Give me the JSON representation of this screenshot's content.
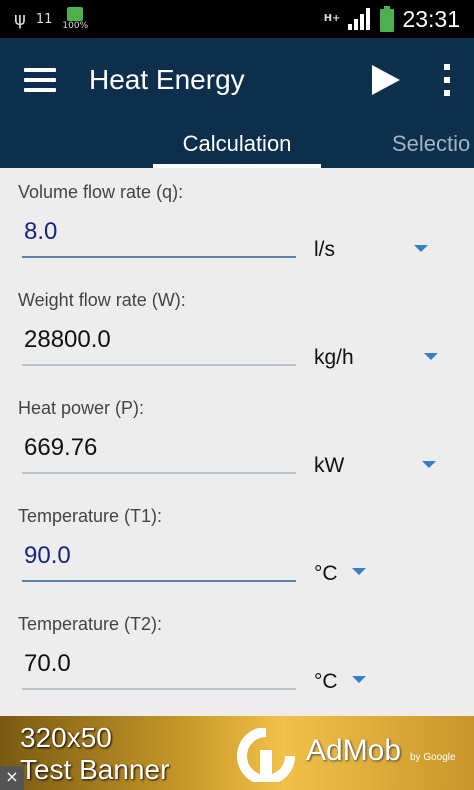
{
  "status_bar": {
    "time": "23:31",
    "battery_label": "100%",
    "network_label": "H+",
    "signal_label": "11"
  },
  "action_bar": {
    "title": "Heat Energy"
  },
  "tabs": [
    {
      "label": "Calculation",
      "selected": true
    },
    {
      "label": "Selectio",
      "selected": false
    }
  ],
  "fields": [
    {
      "label": "Volume flow rate (q):",
      "value": "8.0",
      "unit": "l/s",
      "editable": true
    },
    {
      "label": "Weight flow rate (W):",
      "value": "28800.0",
      "unit": "kg/h",
      "editable": false
    },
    {
      "label": "Heat power (P):",
      "value": "669.76",
      "unit": "kW",
      "editable": false
    },
    {
      "label": "Temperature (T1):",
      "value": "90.0",
      "unit": "°C",
      "editable": true
    },
    {
      "label": "Temperature (T2):",
      "value": "70.0",
      "unit": "°C",
      "editable": false
    }
  ],
  "ad": {
    "line1": "320x50",
    "line2": "Test Banner",
    "brand": "AdMob",
    "brand_by": "by Google",
    "close": "×"
  },
  "colors": {
    "primary": "#0d2f4b",
    "accent": "#3a7ec4",
    "editable_value": "#1a237e"
  }
}
